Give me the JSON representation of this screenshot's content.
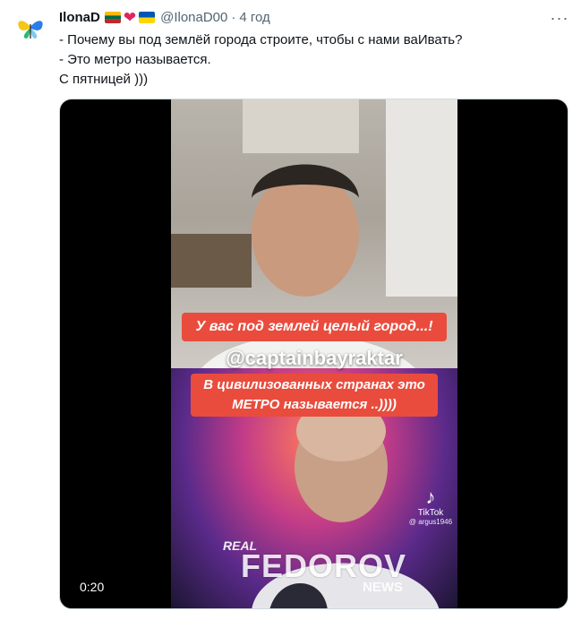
{
  "tweet": {
    "author_name": "IlonaD",
    "author_handle": "@IlonaD00",
    "time": "4 год",
    "icons": [
      "avatar-butterfly-icon",
      "lithuania-flag-icon",
      "heart-icon",
      "ukraine-flag-icon",
      "more-icon"
    ],
    "colors": {
      "heart": "#e0245e",
      "secondary_text": "#536471"
    },
    "text_lines": [
      "- Почему вы под землёй города строите, чтобы с нами ваИвать?",
      "- Это метро называется.",
      "С пятницей )))"
    ]
  },
  "media": {
    "duration": "0:20",
    "captions": {
      "line1": "У вас под землей целый город...!",
      "line2": "@captainbayraktar",
      "line3a": "В цивилизованных странах это",
      "line3b": "МЕТРО называется ..))))"
    },
    "tiktok": {
      "label": "TikTok",
      "handle": "@ argus1946"
    },
    "watermark": {
      "top": "REAL",
      "main": "FEDOROV",
      "bottom": "NEWS"
    },
    "caption_color": "#e94c3d"
  }
}
